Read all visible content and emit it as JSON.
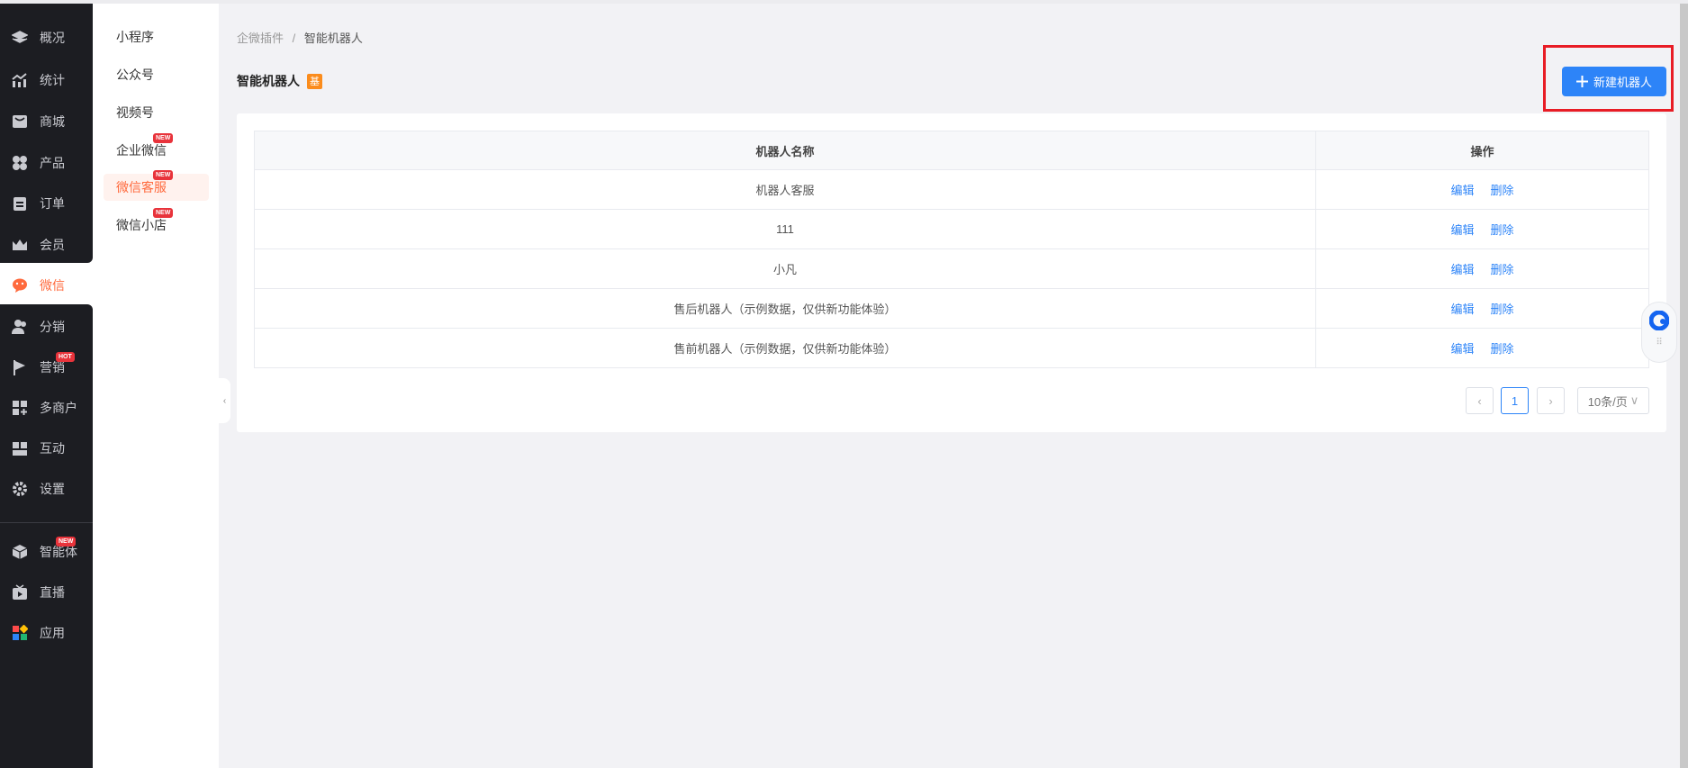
{
  "nav": [
    {
      "label": "概况",
      "icon": "layers-icon"
    },
    {
      "label": "统计",
      "icon": "chart-icon"
    },
    {
      "label": "商城",
      "icon": "shop-icon"
    },
    {
      "label": "产品",
      "icon": "grid-icon"
    },
    {
      "label": "订单",
      "icon": "clipboard-icon"
    },
    {
      "label": "会员",
      "icon": "crown-icon"
    },
    {
      "label": "微信",
      "icon": "wechat-icon"
    },
    {
      "label": "分销",
      "icon": "users-icon"
    },
    {
      "label": "营销",
      "icon": "flag-icon",
      "tag": "HOT"
    },
    {
      "label": "多商户",
      "icon": "store-plus-icon"
    },
    {
      "label": "互动",
      "icon": "interact-icon"
    },
    {
      "label": "设置",
      "icon": "gear-icon"
    },
    {
      "label": "智能体",
      "icon": "cube-icon",
      "tag": "NEW"
    },
    {
      "label": "直播",
      "icon": "tv-icon"
    },
    {
      "label": "应用",
      "icon": "apps-icon"
    }
  ],
  "subnav": [
    {
      "label": "小程序"
    },
    {
      "label": "公众号"
    },
    {
      "label": "视频号"
    },
    {
      "label": "企业微信",
      "tag": "NEW"
    },
    {
      "label": "微信客服",
      "tag": "NEW"
    },
    {
      "label": "微信小店",
      "tag": "NEW"
    }
  ],
  "breadcrumb": {
    "parent": "企微插件",
    "sep": "/",
    "current": "智能机器人"
  },
  "page": {
    "title": "智能机器人",
    "badge": "基",
    "new_button": "新建机器人"
  },
  "table": {
    "headers": [
      "机器人名称",
      "操作"
    ],
    "rows": [
      {
        "name": "机器人客服"
      },
      {
        "name": "111"
      },
      {
        "name": "小凡"
      },
      {
        "name": "售后机器人（示例数据，仅供新功能体验）"
      },
      {
        "name": "售前机器人（示例数据，仅供新功能体验）"
      }
    ],
    "edit": "编辑",
    "delete": "删除"
  },
  "pagination": {
    "current": "1",
    "page_size": "10条/页"
  },
  "colors": {
    "accent": "#2d84f8",
    "active": "#ff6a3d",
    "sidebar": "#1c1d22"
  }
}
